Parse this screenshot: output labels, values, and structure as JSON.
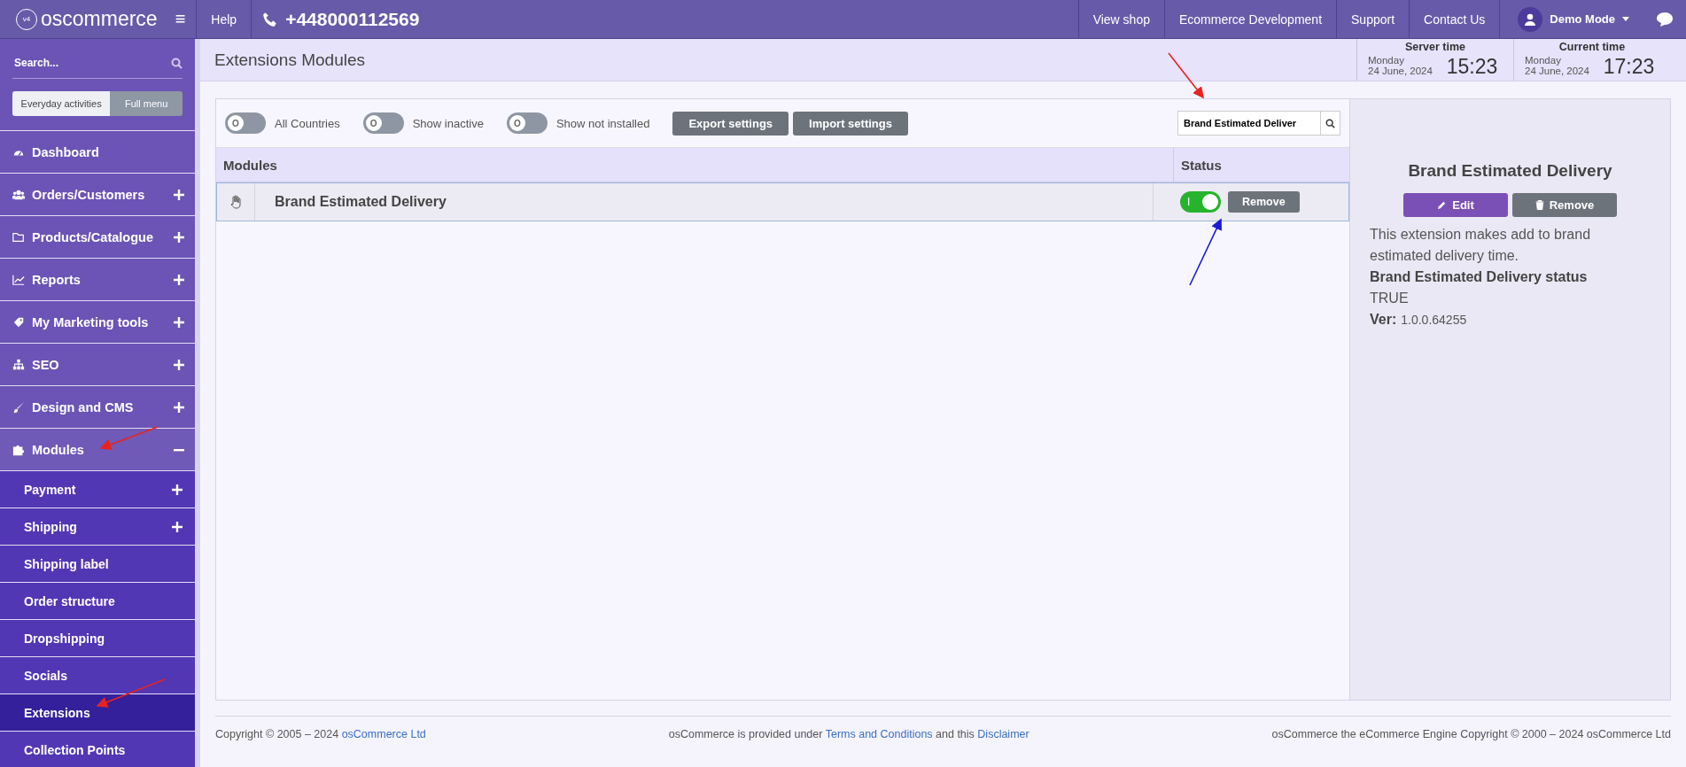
{
  "header": {
    "logo": "oscommerce",
    "logo_badge": "v4",
    "menu_glyph": "≡",
    "help": "Help",
    "phone": "+448000112569",
    "links": [
      "View shop",
      "Ecommerce Development",
      "Support",
      "Contact Us"
    ],
    "user": "Demo Mode"
  },
  "sidebar": {
    "search": {
      "placeholder": "Search..."
    },
    "modes": [
      {
        "label": "Everyday activities",
        "selected": false
      },
      {
        "label": "Full menu",
        "selected": true
      }
    ],
    "items": [
      {
        "label": "Dashboard",
        "kind": "link"
      },
      {
        "label": "Orders/Customers",
        "kind": "group",
        "expanded": false
      },
      {
        "label": "Products/Catalogue",
        "kind": "group",
        "expanded": false
      },
      {
        "label": "Reports",
        "kind": "group",
        "expanded": false
      },
      {
        "label": "My Marketing tools",
        "kind": "group",
        "expanded": false
      },
      {
        "label": "SEO",
        "kind": "group",
        "expanded": false
      },
      {
        "label": "Design and CMS",
        "kind": "group",
        "expanded": false
      },
      {
        "label": "Modules",
        "kind": "group",
        "expanded": true,
        "children": [
          {
            "label": "Payment",
            "kind": "group",
            "expanded": false,
            "selected": false
          },
          {
            "label": "Shipping",
            "kind": "group",
            "expanded": false,
            "selected": false
          },
          {
            "label": "Shipping label",
            "kind": "link",
            "selected": false
          },
          {
            "label": "Order structure",
            "kind": "link",
            "selected": false
          },
          {
            "label": "Dropshipping",
            "kind": "link",
            "selected": false
          },
          {
            "label": "Socials",
            "kind": "link",
            "selected": false
          },
          {
            "label": "Extensions",
            "kind": "link",
            "selected": true
          },
          {
            "label": "Collection Points",
            "kind": "link",
            "selected": false
          }
        ]
      }
    ]
  },
  "page_title": "Extensions Modules",
  "clocks": [
    {
      "label": "Server time",
      "day": "Monday",
      "date": "24 June, 2024",
      "time": "15:23"
    },
    {
      "label": "Current time",
      "day": "Monday",
      "date": "24 June, 2024",
      "time": "17:23"
    }
  ],
  "toolbar": {
    "toggles": [
      {
        "label": "All Countries",
        "on": false,
        "knob": "O"
      },
      {
        "label": "Show inactive",
        "on": false,
        "knob": "O"
      },
      {
        "label": "Show not installed",
        "on": false,
        "knob": "O"
      }
    ],
    "buttons": [
      "Export settings",
      "Import settings"
    ],
    "search": {
      "value": "Brand Estimated Deliver"
    }
  },
  "table": {
    "columns": [
      "Modules",
      "Status"
    ],
    "rows": [
      {
        "name": "Brand Estimated Delivery",
        "on": true,
        "knob": "I",
        "action": "Remove",
        "selected": true
      }
    ]
  },
  "details": {
    "title": "Brand Estimated Delivery",
    "buttons": [
      {
        "label": "Edit",
        "kind": "edit"
      },
      {
        "label": "Remove",
        "kind": "remove"
      }
    ],
    "description": "This extension makes add to brand estimated delivery time.",
    "status_label": "Brand Estimated Delivery status",
    "status_value": "TRUE",
    "version_label": "Ver:",
    "version": "1.0.0.64255"
  },
  "footer": {
    "left": [
      {
        "text": "Copyright © 2005 – 2024 ",
        "link": false
      },
      {
        "text": "osCommerce Ltd",
        "link": true
      }
    ],
    "middle": [
      {
        "text": "osCommerce is provided under ",
        "link": false
      },
      {
        "text": "Terms and Conditions",
        "link": true
      },
      {
        "text": " and this ",
        "link": false
      },
      {
        "text": "Disclaimer",
        "link": true
      }
    ],
    "right": [
      {
        "text": "osCommerce the eCommerce Engine Copyright © 2000 – 2024 osCommerce Ltd",
        "link": false
      }
    ]
  }
}
